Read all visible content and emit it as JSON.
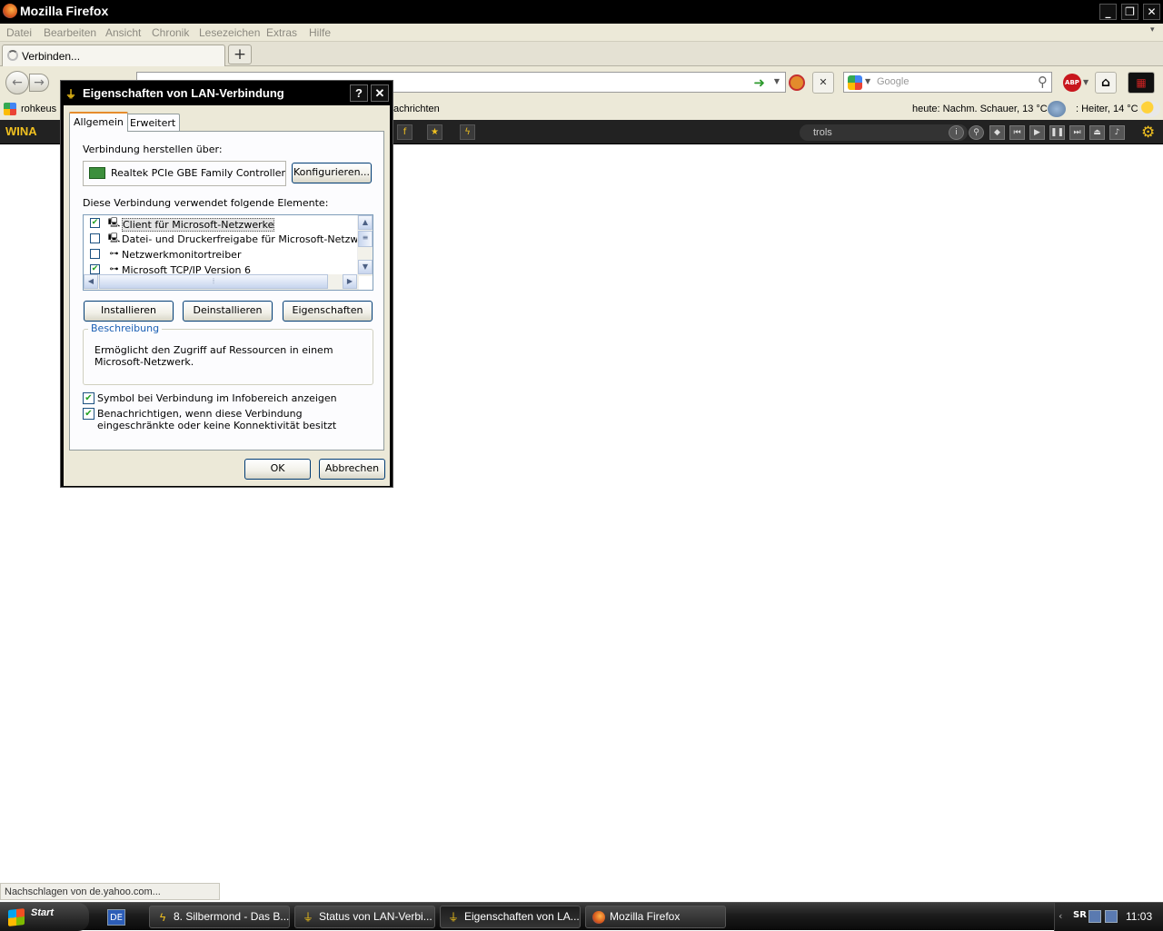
{
  "firefox": {
    "title": "Mozilla Firefox",
    "menu": [
      "Datei",
      "Bearbeiten",
      "Ansicht",
      "Chronik",
      "Lesezeichen",
      "Extras",
      "Hilfe"
    ],
    "tab_label": "Verbinden...",
    "search_placeholder": "Google",
    "bookmarks": {
      "item1": "rohkeus",
      "item2": "achrichten",
      "weather_today": "heute: Nachm. Schauer, 13 °C",
      "weather_now": ": Heiter, 14 °C"
    },
    "winamp": {
      "logo": "WINA",
      "track": "trols"
    },
    "status": "Nachschlagen von de.yahoo.com..."
  },
  "dialog": {
    "title": "Eigenschaften von LAN-Verbindung",
    "help": "?",
    "close": "✕",
    "tabs": [
      "Allgemein",
      "Erweitert"
    ],
    "connect_via_label": "Verbindung herstellen über:",
    "adapter_name": "Realtek PCIe GBE Family Controller",
    "configure_button": "Konfigurieren...",
    "elements_label": "Diese Verbindung verwendet folgende Elemente:",
    "components": [
      {
        "label": "Client für Microsoft-Netzwerke",
        "checked": true,
        "icon": "computer-icon"
      },
      {
        "label": "Datei- und Druckerfreigabe für Microsoft-Netzwerke",
        "checked": false,
        "icon": "computer-icon"
      },
      {
        "label": "Netzwerkmonitortreiber",
        "checked": false,
        "icon": "network-protocol-icon"
      },
      {
        "label": "Microsoft TCP/IP Version 6",
        "checked": true,
        "icon": "network-protocol-icon"
      }
    ],
    "buttons": {
      "install": "Installieren",
      "uninstall": "Deinstallieren",
      "properties": "Eigenschaften"
    },
    "description_title": "Beschreibung",
    "description_text": "Ermöglicht den Zugriff auf Ressourcen in einem Microsoft-Netzwerk.",
    "checkbox_show_icon": {
      "label": "Symbol bei Verbindung im Infobereich anzeigen",
      "checked": true
    },
    "checkbox_notify": {
      "label": "Benachrichtigen, wenn diese Verbindung eingeschränkte oder keine Konnektivität besitzt",
      "checked": true
    },
    "ok": "OK",
    "cancel": "Abbrechen"
  },
  "taskbar": {
    "start": "Start",
    "lang": "DE",
    "tasks": [
      "8. Silbermond - Das B...",
      "Status von LAN-Verbi...",
      "Eigenschaften von LA...",
      "Mozilla Firefox"
    ],
    "tray_text": "SR",
    "clock": "11:03"
  }
}
